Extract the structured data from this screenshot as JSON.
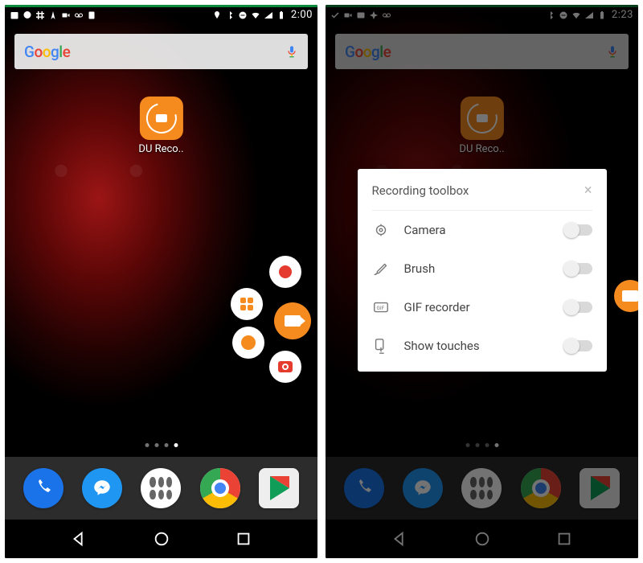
{
  "left": {
    "status": {
      "time": "2:00"
    },
    "search": {
      "brand": "Google"
    },
    "app": {
      "label": "DU Reco.."
    },
    "dock": [
      "Phone",
      "Messenger",
      "App drawer",
      "Chrome",
      "Play Store"
    ]
  },
  "right": {
    "status": {
      "time": "2:23"
    },
    "search": {
      "brand": "Google"
    },
    "app": {
      "label": "DU Reco.."
    },
    "dialog": {
      "title": "Recording toolbox",
      "rows": [
        {
          "label": "Camera",
          "on": false
        },
        {
          "label": "Brush",
          "on": false
        },
        {
          "label": "GIF recorder",
          "on": false
        },
        {
          "label": "Show touches",
          "on": false
        }
      ]
    },
    "dock": [
      "Phone",
      "Messenger",
      "App drawer",
      "Chrome",
      "Play Store"
    ]
  },
  "colors": {
    "accent": "#f58a1f",
    "record": "#e43b2e"
  }
}
